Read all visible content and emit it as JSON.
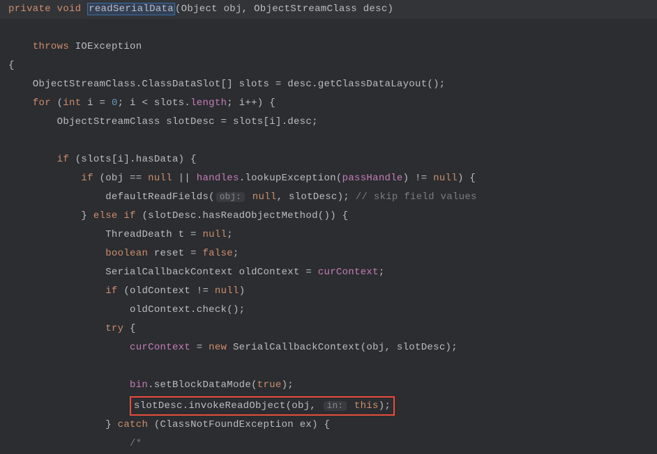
{
  "code": {
    "line1": {
      "kw1": "private",
      "kw2": "void",
      "method": "readSerialData",
      "params": "(Object obj, ObjectStreamClass desc)"
    },
    "line2": {
      "kw1": "throws",
      "ex": "IOException"
    },
    "line3": "{",
    "line4": "ObjectStreamClass.ClassDataSlot[] slots = desc.getClassDataLayout();",
    "line5": {
      "kw1": "for",
      "pre": " (",
      "kw2": "int",
      "mid1": " i = ",
      "zero": "0",
      "mid2": "; i < slots.",
      "field": "length",
      "tail": "; i++) {"
    },
    "line6": "ObjectStreamClass slotDesc = slots[i].desc;",
    "line8": {
      "kw1": "if",
      "rest": " (slots[i].hasData) {"
    },
    "line9": {
      "kw1": "if",
      "pre": " (obj == ",
      "n1": "null",
      "mid1": " || ",
      "field": "handles",
      "mid2": ".lookupException(",
      "field2": "passHandle",
      "mid3": ") != ",
      "n2": "null",
      "tail": ") {"
    },
    "line10": {
      "fn": "defaultReadFields(",
      "inlay": "obj:",
      "n1": "null",
      "mid": ", slotDesc); ",
      "comment": "// skip field values"
    },
    "line11": {
      "pre": "} ",
      "kw1": "else if",
      "rest": " (slotDesc.hasReadObjectMethod()) {"
    },
    "line12": {
      "pre": "ThreadDeath t = ",
      "n": "null",
      "tail": ";"
    },
    "line13": {
      "kw": "boolean",
      "mid": " reset = ",
      "val": "false",
      "tail": ";"
    },
    "line14": {
      "pre": "SerialCallbackContext oldContext = ",
      "field": "curContext",
      "tail": ";"
    },
    "line15": {
      "kw": "if",
      "pre": " (oldContext != ",
      "n": "null",
      "tail": ")"
    },
    "line16": "oldContext.check();",
    "line17": {
      "kw": "try",
      "tail": " {"
    },
    "line18": {
      "field": "curContext",
      "mid": " = ",
      "kw": "new",
      "tail": " SerialCallbackContext(obj, slotDesc);"
    },
    "line20": {
      "field": "bin",
      "mid": ".setBlockDataMode(",
      "kw": "true",
      "tail": ");"
    },
    "line21": {
      "pre": "slotDesc.invokeReadObject(obj, ",
      "inlay": "in:",
      "kw": "this",
      "tail": ");"
    },
    "line22": {
      "pre": "} ",
      "kw": "catch",
      "rest": " (ClassNotFoundException ex) {"
    },
    "line23": "/*"
  }
}
